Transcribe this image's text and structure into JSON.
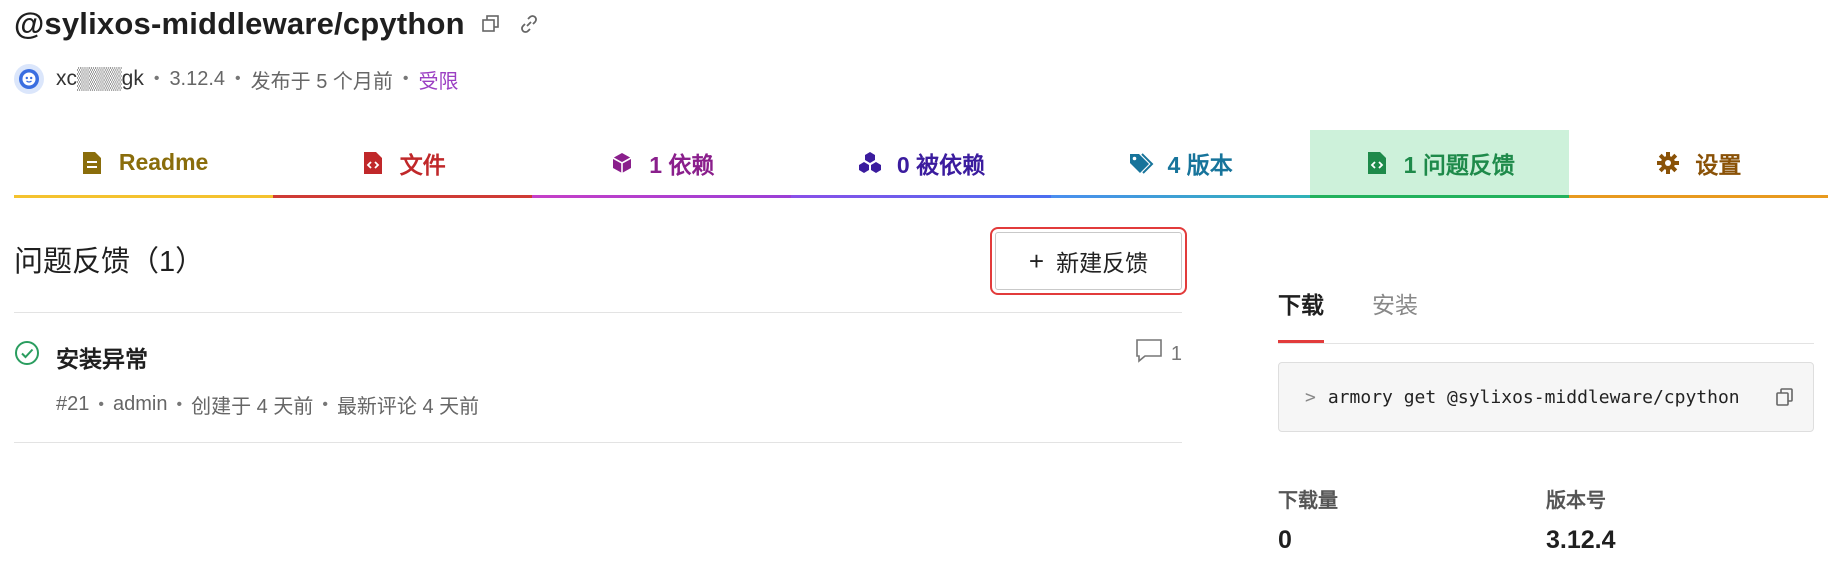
{
  "header": {
    "title": "@sylixos-middleware/cpython",
    "author": "xc▒▒▒gk",
    "version": "3.12.4",
    "published": "发布于 5 个月前",
    "access": "受限",
    "separator": "•"
  },
  "tabs": [
    {
      "label": "Readme",
      "icon": "document-icon"
    },
    {
      "label": "文件",
      "icon": "code-file-icon"
    },
    {
      "label": "1 依赖",
      "icon": "cube-icon"
    },
    {
      "label": "0 被依赖",
      "icon": "cubes-icon"
    },
    {
      "label": "4 版本",
      "icon": "tags-icon"
    },
    {
      "label": "1 问题反馈",
      "icon": "code-file-icon",
      "active": true
    },
    {
      "label": "设置",
      "icon": "gear-icon"
    }
  ],
  "issues": {
    "heading": "问题反馈（1）",
    "new_button": "新建反馈",
    "new_button_icon": "+",
    "items": [
      {
        "title": "安装异常",
        "number": "#21",
        "author": "admin",
        "created": "创建于 4 天前",
        "last_comment": "最新评论 4 天前",
        "comments": "1",
        "status": "closed"
      }
    ]
  },
  "sidebar": {
    "tabs": [
      "下载",
      "安装"
    ],
    "active_tab": "下载",
    "prompt": ">",
    "command": "armory get @sylixos-middleware/cpython",
    "stats": [
      {
        "label": "下载量",
        "value": "0"
      },
      {
        "label": "版本号",
        "value": "3.12.4"
      }
    ]
  },
  "colors": {
    "readme": "#8a6d0b",
    "files": "#c0282a",
    "deps": "#8a1f8c",
    "revdeps": "#3b1c9e",
    "versions": "#17749b",
    "issues": "#1e8a4a",
    "issues_bg": "#cdf1da",
    "settings": "#8a5207",
    "highlight": "#e23b3b"
  }
}
